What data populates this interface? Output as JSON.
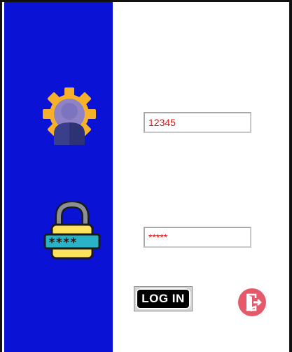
{
  "login_form": {
    "username_value": "12345",
    "password_value": "*****",
    "login_button_label": "LOG IN"
  },
  "icons": {
    "user": "user-settings-icon",
    "password": "password-lock-icon",
    "exit": "exit-door-icon"
  },
  "colors": {
    "side_panel": "#0a12d6",
    "field_text": "#e01010",
    "exit_button": "#e45a6a",
    "gear": "#f7b02a",
    "lock_body": "#ffe35c"
  }
}
